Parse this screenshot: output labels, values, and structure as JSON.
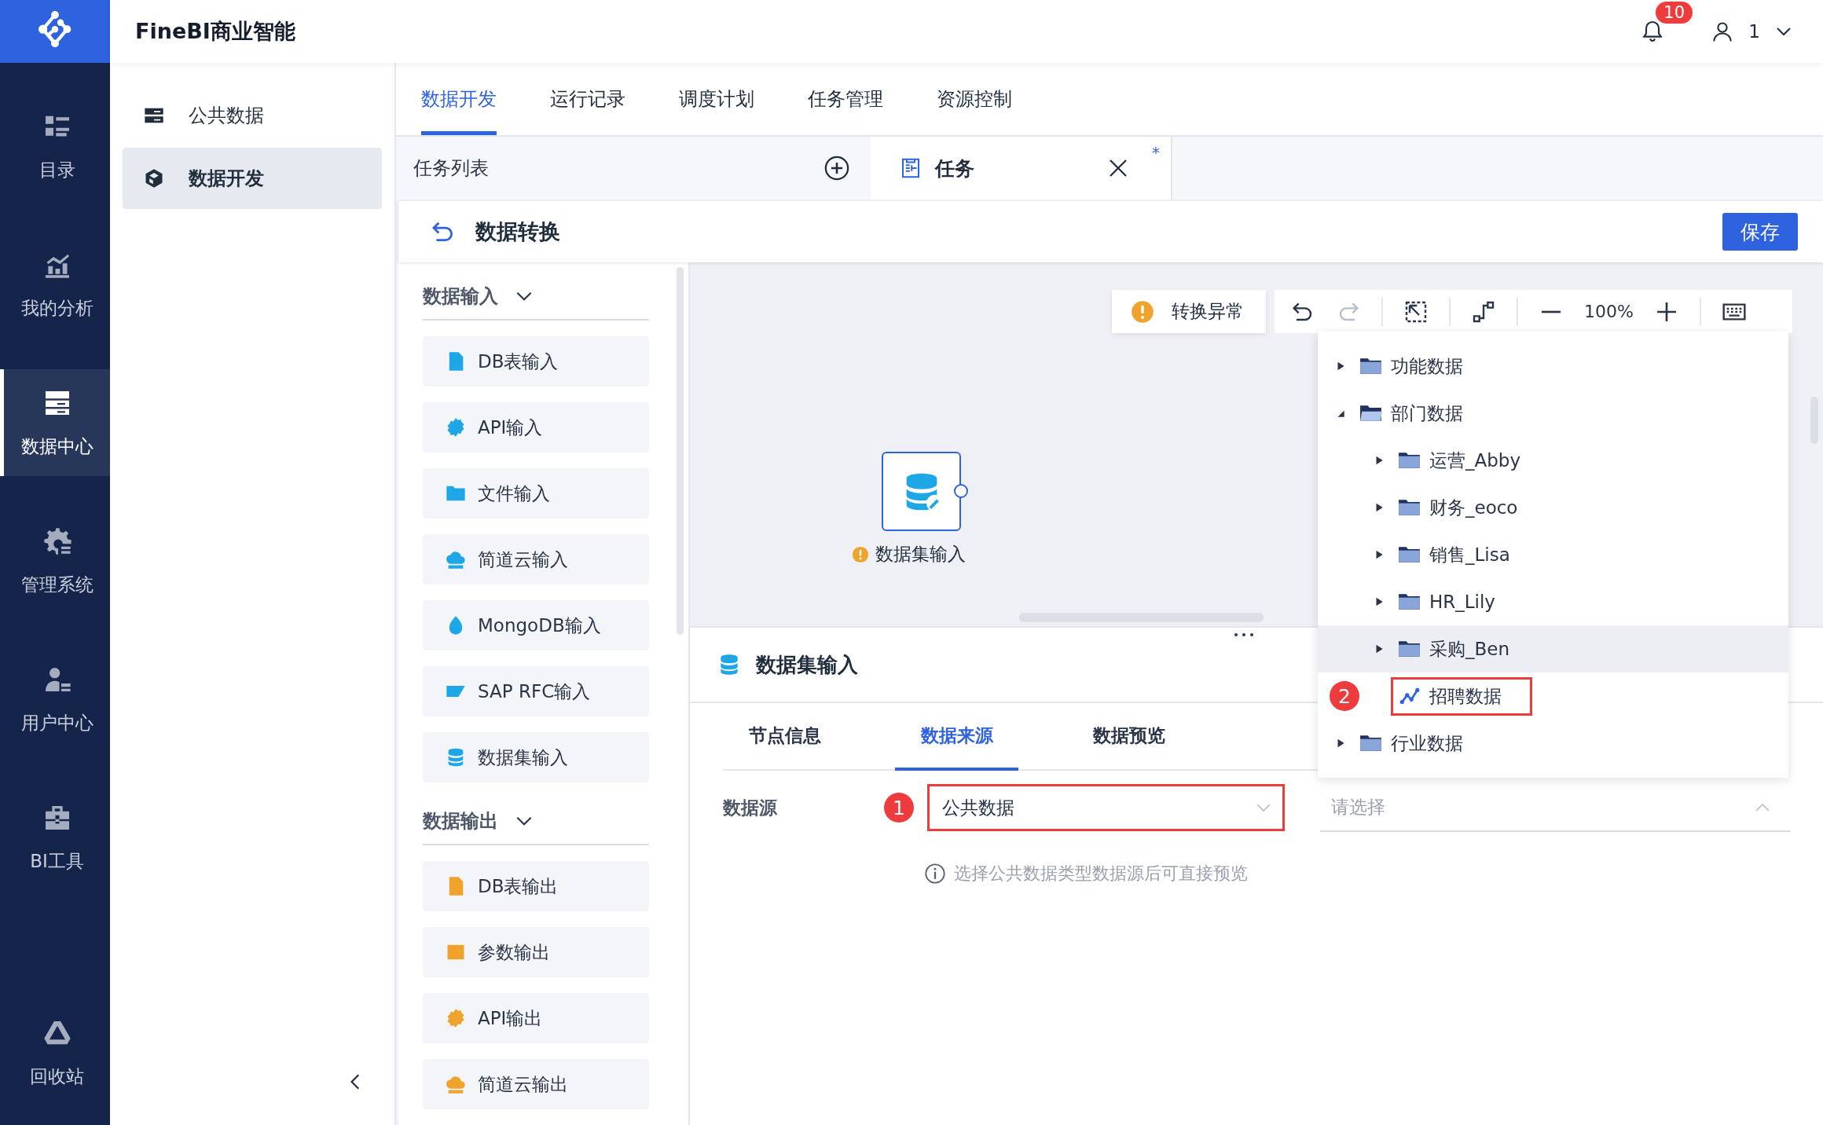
{
  "app": {
    "title": "FineBI商业智能",
    "notification_count": "10",
    "user_name": "1"
  },
  "nav": [
    {
      "label": "目录",
      "selected": false
    },
    {
      "label": "我的分析",
      "selected": false
    },
    {
      "label": "数据中心",
      "selected": true
    },
    {
      "label": "管理系统",
      "selected": false
    },
    {
      "label": "用户中心",
      "selected": false
    },
    {
      "label": "BI工具",
      "selected": false
    },
    {
      "label": "回收站",
      "selected": false
    }
  ],
  "sidebar": {
    "items": [
      {
        "label": "公共数据",
        "selected": false
      },
      {
        "label": "数据开发",
        "selected": true
      }
    ]
  },
  "tabs": [
    {
      "label": "数据开发",
      "selected": true
    },
    {
      "label": "运行记录",
      "selected": false
    },
    {
      "label": "调度计划",
      "selected": false
    },
    {
      "label": "任务管理",
      "selected": false
    },
    {
      "label": "资源控制",
      "selected": false
    }
  ],
  "task_bar": {
    "list_title": "任务列表",
    "open_tab": {
      "label": "任务",
      "unsaved_mark": "*"
    }
  },
  "editor": {
    "title": "数据转换",
    "save_button": "保存"
  },
  "palette": [
    {
      "title": "数据输入",
      "kind": "input",
      "expanded": true,
      "items": [
        "DB表输入",
        "API输入",
        "文件输入",
        "简道云输入",
        "MongoDB输入",
        "SAP RFC输入",
        "数据集输入"
      ]
    },
    {
      "title": "数据输出",
      "kind": "output",
      "expanded": true,
      "items": [
        "DB表输出",
        "参数输出",
        "API输出",
        "简道云输出"
      ]
    }
  ],
  "canvas": {
    "status": "转换异常",
    "undo_enabled": true,
    "redo_enabled": false,
    "zoom": "100%",
    "node": {
      "label": "数据集输入",
      "warning": true
    }
  },
  "dropdown_tree": [
    {
      "label": "功能数据",
      "kind": "folder",
      "expanded": false,
      "hovered": false
    },
    {
      "label": "部门数据",
      "kind": "folder",
      "expanded": true,
      "hovered": false,
      "children": [
        {
          "label": "运营_Abby",
          "kind": "folder",
          "expanded": false,
          "hovered": false
        },
        {
          "label": "财务_eoco",
          "kind": "folder",
          "expanded": false,
          "hovered": false
        },
        {
          "label": "销售_Lisa",
          "kind": "folder",
          "expanded": false,
          "hovered": false
        },
        {
          "label": "HR_Lily",
          "kind": "folder",
          "expanded": false,
          "hovered": false
        },
        {
          "label": "采购_Ben",
          "kind": "folder",
          "expanded": false,
          "hovered": true
        },
        {
          "label": "招聘数据",
          "kind": "dataset",
          "hovered": false,
          "annotation": "2"
        }
      ]
    },
    {
      "label": "行业数据",
      "kind": "folder",
      "expanded": false,
      "hovered": false
    }
  ],
  "node_panel": {
    "title": "数据集输入",
    "tabs": [
      {
        "label": "节点信息",
        "selected": false
      },
      {
        "label": "数据来源",
        "selected": true
      },
      {
        "label": "数据预览",
        "selected": false
      }
    ],
    "field_label": "数据源",
    "source": {
      "value": "公共数据",
      "annotation": "1"
    },
    "table_select": {
      "placeholder": "请选择",
      "open": true
    },
    "hint": "选择公共数据类型数据源后可直接预览"
  }
}
